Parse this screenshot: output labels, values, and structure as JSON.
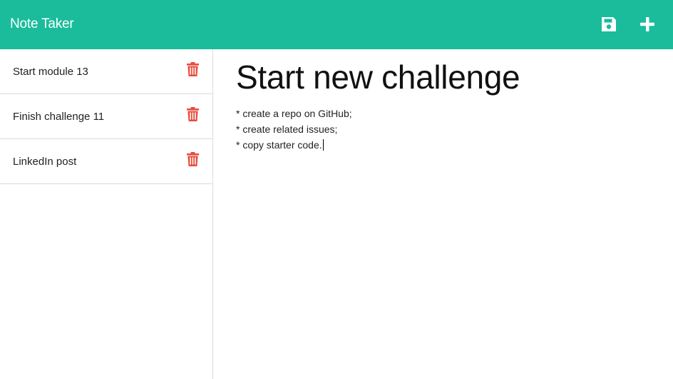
{
  "app": {
    "title": "Note Taker",
    "accent_color": "#1abc9c",
    "delete_color": "#e74c3c"
  },
  "toolbar": {
    "save_icon": "floppy-disk-icon",
    "new_icon": "plus-icon"
  },
  "notes": [
    {
      "title": "Start module 13"
    },
    {
      "title": "Finish challenge 11"
    },
    {
      "title": "LinkedIn post"
    }
  ],
  "editor": {
    "title": "Start new challenge",
    "lines": [
      "* create a repo on GitHub;",
      "* create related issues;",
      "* copy starter code."
    ]
  }
}
